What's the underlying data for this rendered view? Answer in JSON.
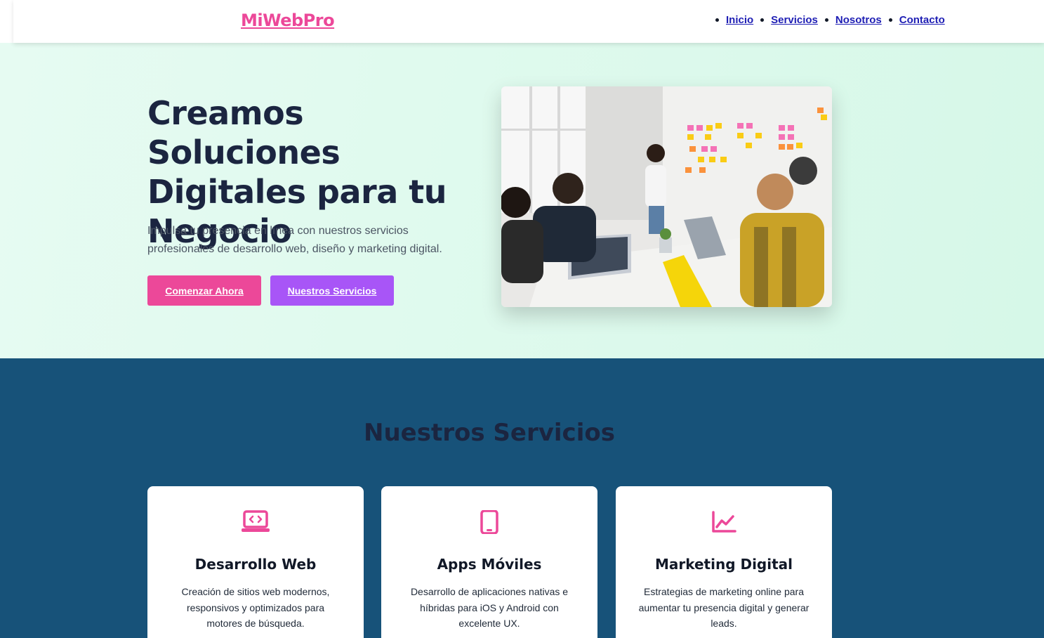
{
  "header": {
    "logo": "MiWebPro",
    "nav": [
      {
        "label": "Inicio"
      },
      {
        "label": "Servicios"
      },
      {
        "label": "Nosotros"
      },
      {
        "label": "Contacto"
      }
    ]
  },
  "hero": {
    "title": "Creamos Soluciones Digitales para tu Negocio",
    "subtitle": "Impulsa tu presencia en línea con nuestros servicios profesionales de desarrollo web, diseño y marketing digital.",
    "primary_button": "Comenzar Ahora",
    "secondary_button": "Nuestros Servicios"
  },
  "services": {
    "title": "Nuestros Servicios",
    "cards": [
      {
        "icon": "laptop-code-icon",
        "title": "Desarrollo Web",
        "description": "Creación de sitios web modernos, responsivos y optimizados para motores de búsqueda."
      },
      {
        "icon": "mobile-phone-icon",
        "title": "Apps Móviles",
        "description": "Desarrollo de aplicaciones nativas e híbridas para iOS y Android con excelente UX."
      },
      {
        "icon": "chart-line-icon",
        "title": "Marketing Digital",
        "description": "Estrategias de marketing online para aumentar tu presencia digital y generar leads."
      }
    ]
  },
  "colors": {
    "accent": "#ec4899",
    "secondary": "#a855f7",
    "services_bg": "#175279",
    "heading": "#1b2540"
  }
}
